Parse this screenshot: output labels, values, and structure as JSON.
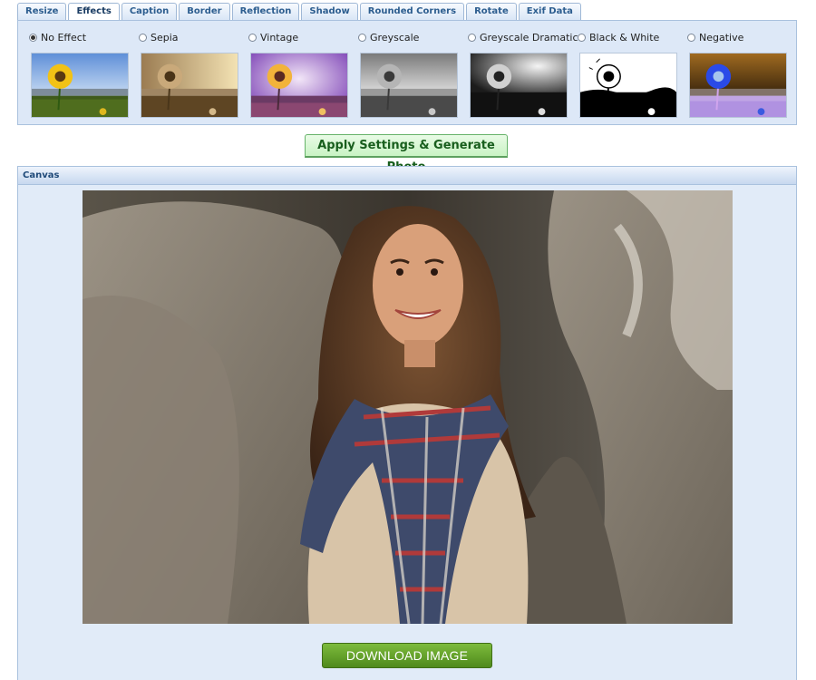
{
  "tabs": [
    {
      "label": "Resize",
      "active": false
    },
    {
      "label": "Effects",
      "active": true
    },
    {
      "label": "Caption",
      "active": false
    },
    {
      "label": "Border",
      "active": false
    },
    {
      "label": "Reflection",
      "active": false
    },
    {
      "label": "Shadow",
      "active": false
    },
    {
      "label": "Rounded Corners",
      "active": false
    },
    {
      "label": "Rotate",
      "active": false
    },
    {
      "label": "Exif Data",
      "active": false
    }
  ],
  "effects": [
    {
      "label": "No Effect",
      "checked": true
    },
    {
      "label": "Sepia",
      "checked": false
    },
    {
      "label": "Vintage",
      "checked": false
    },
    {
      "label": "Greyscale",
      "checked": false
    },
    {
      "label": "Greyscale Dramatic",
      "checked": false
    },
    {
      "label": "Black & White",
      "checked": false
    },
    {
      "label": "Negative",
      "checked": false
    }
  ],
  "apply_button": {
    "label": "Apply Settings & Generate Photo"
  },
  "canvas": {
    "title": "Canvas"
  },
  "download_button": {
    "label": "DOWNLOAD IMAGE"
  },
  "colors": {
    "tab_text": "#2c5d8f",
    "panel_bg": "#dde8f7",
    "panel_border": "#a9c1de",
    "apply_text": "#185e1d",
    "download_bg": "#5e9a25"
  }
}
